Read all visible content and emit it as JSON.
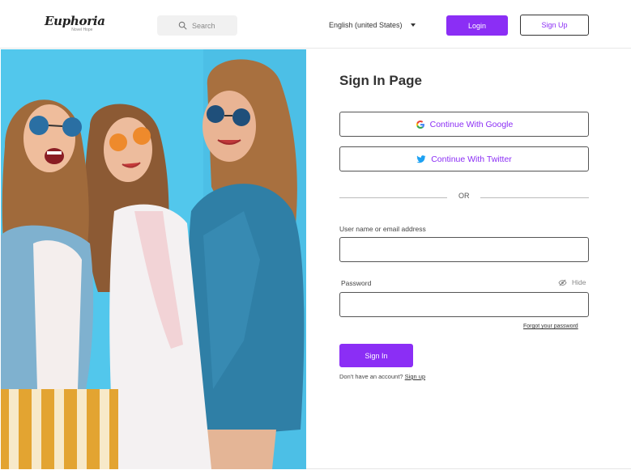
{
  "header": {
    "logo_text": "Euphoria",
    "logo_subtext": "Novel Hope",
    "search_placeholder": "Search",
    "language": "English (united States)",
    "login_label": "Login",
    "signup_label": "Sign Up"
  },
  "form": {
    "title": "Sign In Page",
    "google_label": "Continue With Google",
    "twitter_label": "Continue With Twitter",
    "or_text": "OR",
    "username_label": "User name or email address",
    "username_value": "",
    "password_label": "Password",
    "hide_label": "Hide",
    "password_value": "",
    "forgot_label": "Forgot your password",
    "signin_label": "Sign In",
    "no_account_text": "Don't have an account?",
    "signup_link": "Sign up"
  },
  "colors": {
    "accent": "#8b2ef5",
    "photo_background": "#4fc9ef",
    "twitter_blue": "#1da1f2"
  },
  "icons": {
    "search": "search-icon",
    "dropdown": "chevron-down-icon",
    "google": "google-icon",
    "twitter": "twitter-icon",
    "hide": "eye-slash-icon"
  }
}
